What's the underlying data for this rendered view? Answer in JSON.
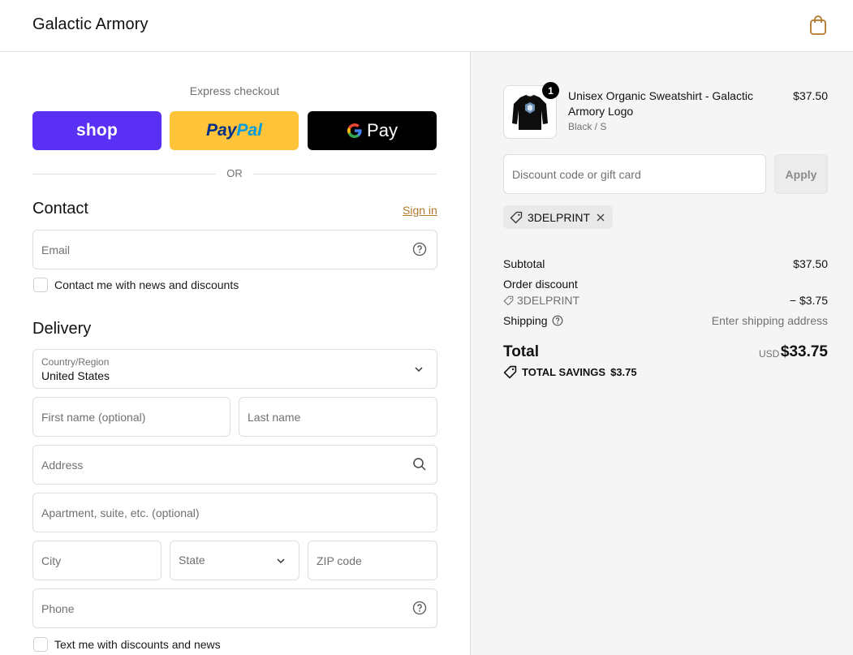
{
  "header": {
    "brand": "Galactic Armory",
    "cart_icon": "shopping-bag-icon"
  },
  "express": {
    "label": "Express checkout",
    "shop_label": "shop",
    "paypal_part1": "Pay",
    "paypal_part2": "Pal",
    "gpay_g": "G",
    "gpay_label": "Pay",
    "or_label": "OR"
  },
  "contact": {
    "heading": "Contact",
    "sign_in": "Sign in",
    "email_placeholder": "Email",
    "news_checkbox_label": "Contact me with news and discounts"
  },
  "delivery": {
    "heading": "Delivery",
    "country_label": "Country/Region",
    "country_value": "United States",
    "first_name_placeholder": "First name (optional)",
    "last_name_placeholder": "Last name",
    "address_placeholder": "Address",
    "apartment_placeholder": "Apartment, suite, etc. (optional)",
    "city_placeholder": "City",
    "state_placeholder": "State",
    "zip_placeholder": "ZIP code",
    "phone_placeholder": "Phone",
    "sms_checkbox_label": "Text me with discounts and news"
  },
  "summary": {
    "item": {
      "quantity": "1",
      "name": "Unisex Organic Sweatshirt - Galactic Armory Logo",
      "variant": "Black / S",
      "price": "$37.50"
    },
    "discount_placeholder": "Discount code or gift card",
    "apply_label": "Apply",
    "applied_code": "3DELPRINT",
    "subtotal_label": "Subtotal",
    "subtotal_value": "$37.50",
    "order_discount_label": "Order discount",
    "order_discount_code": "3DELPRINT",
    "order_discount_value": "− $3.75",
    "shipping_label": "Shipping",
    "shipping_value": "Enter shipping address",
    "total_label": "Total",
    "currency": "USD",
    "total_value": "$33.75",
    "savings_label": "TOTAL SAVINGS",
    "savings_value": "$3.75"
  },
  "colors": {
    "shop": "#5a31f4",
    "paypal": "#ffc439",
    "gpay": "#000000",
    "link": "#b07a2a",
    "summary_bg": "#f5f5f5"
  }
}
